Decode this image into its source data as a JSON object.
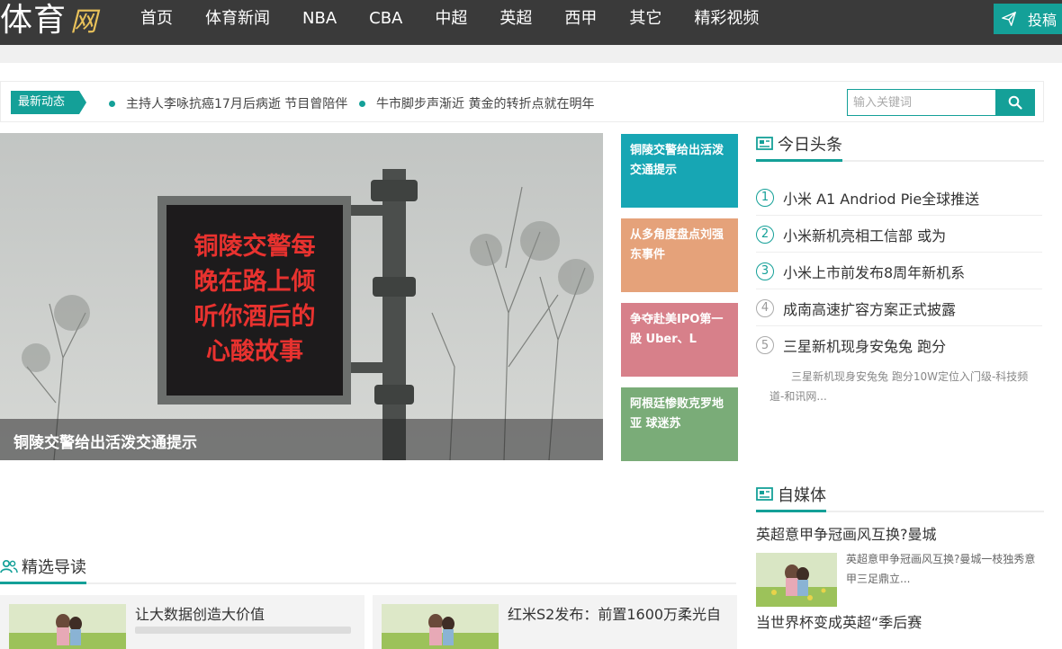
{
  "header": {
    "logo_main": "体育",
    "logo_accent": "网",
    "nav": [
      "首页",
      "体育新闻",
      "NBA",
      "CBA",
      "中超",
      "英超",
      "西甲",
      "其它",
      "精彩视频"
    ],
    "submit_label": "投稿"
  },
  "ticker": {
    "label": "最新动态",
    "items": [
      "主持人李咏抗癌17月后病逝 节目曾陪伴",
      "牛市脚步声渐近 黄金的转折点就在明年"
    ],
    "search_placeholder": "输入关键词"
  },
  "hero": {
    "caption": "铜陵交警给出活泼交通提示",
    "sign_lines": [
      "铜陵交警每",
      "晚在路上倾",
      "听你酒后的",
      "心酸故事"
    ]
  },
  "tiles": [
    {
      "text": "铜陵交警给出活泼交通提示",
      "color": "#17a6b4"
    },
    {
      "text": "从多角度盘点刘强东事件",
      "color": "#e5a27a"
    },
    {
      "text": "争夺赴美IPO第一股 Uber、L",
      "color": "#d7808a"
    },
    {
      "text": "阿根廷惨败克罗地亚 球迷苏",
      "color": "#7aac78"
    }
  ],
  "headlines": {
    "title": "今日头条",
    "items": [
      {
        "num": "1",
        "text": "小米 A1 Andriod Pie全球推送"
      },
      {
        "num": "2",
        "text": "小米新机亮相工信部 或为"
      },
      {
        "num": "3",
        "text": "小米上市前发布8周年新机系"
      },
      {
        "num": "4",
        "text": "成南高速扩容方案正式披露"
      },
      {
        "num": "5",
        "text": "三星新机现身安兔兔 跑分"
      }
    ],
    "summary": "三星新机现身安兔兔 跑分10W定位入门级-科技频道-和讯网..."
  },
  "media": {
    "title": "自媒体",
    "item1_title": "英超意甲争冠画风互换?曼城",
    "item1_desc": "英超意甲争冠画风互换?曼城一枝独秀意甲三足鼎立...",
    "item2_title": "当世界杯变成英超“季后赛"
  },
  "featured": {
    "title": "精选导读",
    "cards": [
      {
        "title": "让大数据创造大价值"
      },
      {
        "title": "红米S2发布：前置1600万柔光自"
      }
    ]
  },
  "colors": {
    "accent": "#14a098",
    "topbar": "#3a3a3a"
  }
}
